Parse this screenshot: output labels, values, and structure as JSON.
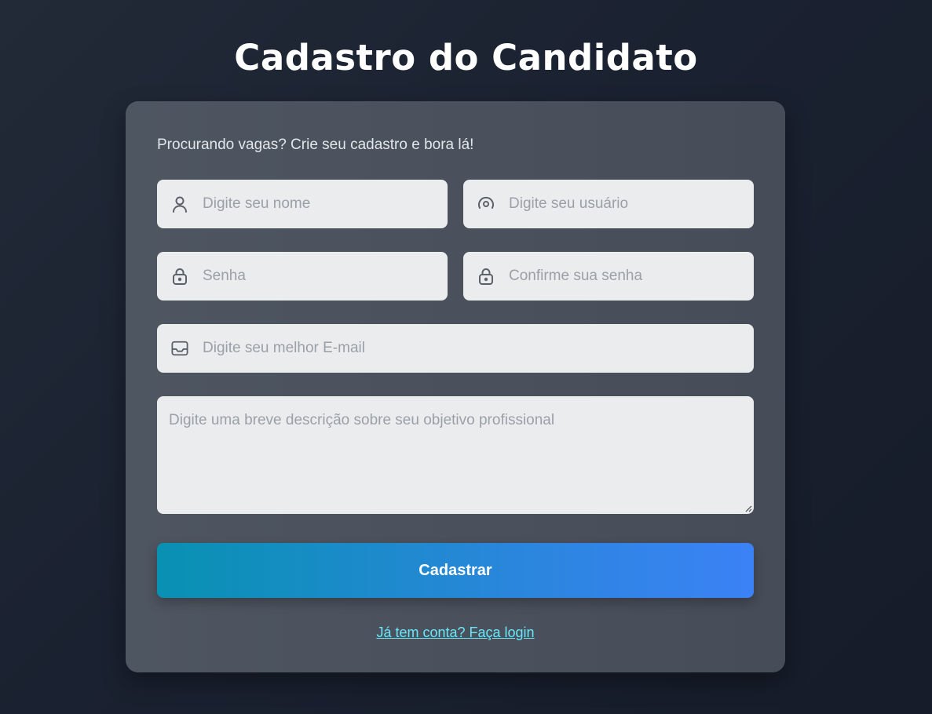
{
  "page": {
    "title": "Cadastro do Candidato"
  },
  "form": {
    "subtitle": "Procurando vagas? Crie seu cadastro e bora lá!",
    "fields": {
      "name": {
        "placeholder": "Digite seu nome",
        "value": "",
        "icon": "user-icon"
      },
      "username": {
        "placeholder": "Digite seu usuário",
        "value": "",
        "icon": "at-sign-icon"
      },
      "password": {
        "placeholder": "Senha",
        "value": "",
        "icon": "lock-icon"
      },
      "confirm_password": {
        "placeholder": "Confirme sua senha",
        "value": "",
        "icon": "lock-icon"
      },
      "email": {
        "placeholder": "Digite seu melhor E-mail",
        "value": "",
        "icon": "inbox-icon"
      },
      "description": {
        "placeholder": "Digite uma breve descrição sobre seu objetivo profissional",
        "value": ""
      }
    },
    "submit_label": "Cadastrar",
    "login_link_label": "Já tem conta? Faça login"
  },
  "colors": {
    "background": "#1a2130",
    "card": "#4a505c",
    "input_background": "#ebecee",
    "button_gradient_start": "#0891b2",
    "button_gradient_end": "#3b82f6",
    "link": "#67e8f9"
  }
}
